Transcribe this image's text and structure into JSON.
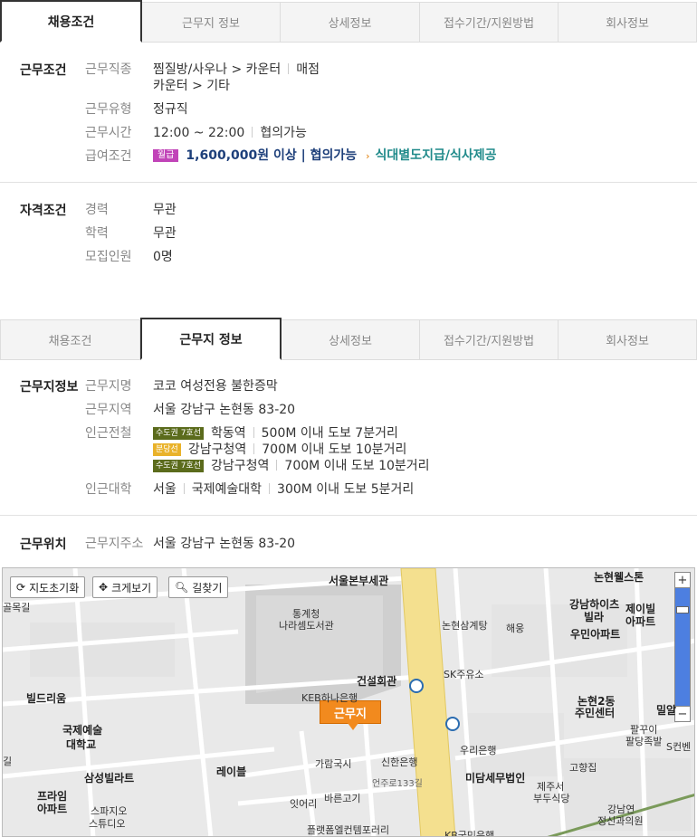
{
  "tabs1": [
    "채용조건",
    "근무지 정보",
    "상세정보",
    "접수기간/지원방법",
    "회사정보"
  ],
  "tabs2": [
    "채용조건",
    "근무지 정보",
    "상세정보",
    "접수기간/지원방법",
    "회사정보"
  ],
  "work": {
    "title": "근무조건",
    "job_label": "근무직종",
    "job_line1a": "찜질방/사우나 > 카운터",
    "job_line1b": "매점",
    "job_line2": "카운터 > 기타",
    "type_label": "근무유형",
    "type_value": "정규직",
    "time_label": "근무시간",
    "time_value": "12:00 ~ 22:00",
    "time_note": "협의가능",
    "pay_label": "급여조건",
    "pay_badge": "월급",
    "pay_value": "1,600,000원 이상 | 협의가능",
    "pay_meal": "식대별도지급/식사제공"
  },
  "qual": {
    "title": "자격조건",
    "career_label": "경력",
    "career_value": "무관",
    "edu_label": "학력",
    "edu_value": "무관",
    "count_label": "모집인원",
    "count_value": "0명"
  },
  "place": {
    "title": "근무지정보",
    "name_label": "근무지명",
    "name_value": "코코 여성전용 불한증막",
    "area_label": "근무지역",
    "area_value": "서울 강남구 논현동 83-20",
    "subway_label": "인근전철",
    "subway": [
      {
        "badge": "수도권 7호선",
        "station": "학동역",
        "dist": "500M 이내 도보 7분거리"
      },
      {
        "badge": "분당선",
        "station": "강남구청역",
        "dist": "700M 이내 도보 10분거리"
      },
      {
        "badge": "수도권 7호선",
        "station": "강남구청역",
        "dist": "700M 이내 도보 10분거리"
      }
    ],
    "univ_label": "인근대학",
    "univ_region": "서울",
    "univ_name": "국제예술대학",
    "univ_dist": "300M 이내 도보 5분거리"
  },
  "loc": {
    "title": "근무위치",
    "addr_label": "근무지주소",
    "addr_value": "서울 강남구 논현동 83-20"
  },
  "map": {
    "btn_reset": "지도초기화",
    "btn_enlarge": "크게보기",
    "btn_route": "길찾기",
    "pin": "근무지",
    "labels": {
      "l1": "서울본부세관",
      "l2": "논현웰스톤",
      "l3": "골목길",
      "l4": "통계청",
      "l5": "나라셈도서관",
      "l6": "논현삼계탕",
      "l7": "해웅",
      "l8": "강남하이츠",
      "l9": "빌라",
      "l10": "제이빌",
      "l11": "아파트",
      "l12": "우민아파트",
      "l13": "SK주유소",
      "l14": "건설회관",
      "l15": "KEB하나은행",
      "l16": "빌드리움",
      "l17": "국제예술",
      "l18": "대학교",
      "l19": "논현2동",
      "l20": "주민센터",
      "l21": "밀알",
      "l22": "우리은행",
      "l23": "팔꾸이",
      "l24": "팔당족발",
      "l25": "S컨벤",
      "l26": "레이블",
      "l27": "가람국시",
      "l28": "신한은행",
      "l29": "미담세무법인",
      "l30": "고향집",
      "l31": "삼성빌라트",
      "l32": "제주서",
      "l33": "부두식당",
      "l34": "프라임",
      "l35": "아파트",
      "l36": "잇어리",
      "l37": "바른고기",
      "l38": "언주로133길",
      "l39": "강남연",
      "l40": "정신과의원",
      "l41": "스파지오",
      "l42": "스튜디오",
      "l43": "플랫폼엘컨템포러리",
      "l44": "KB국민은행",
      "l45": "길"
    }
  }
}
